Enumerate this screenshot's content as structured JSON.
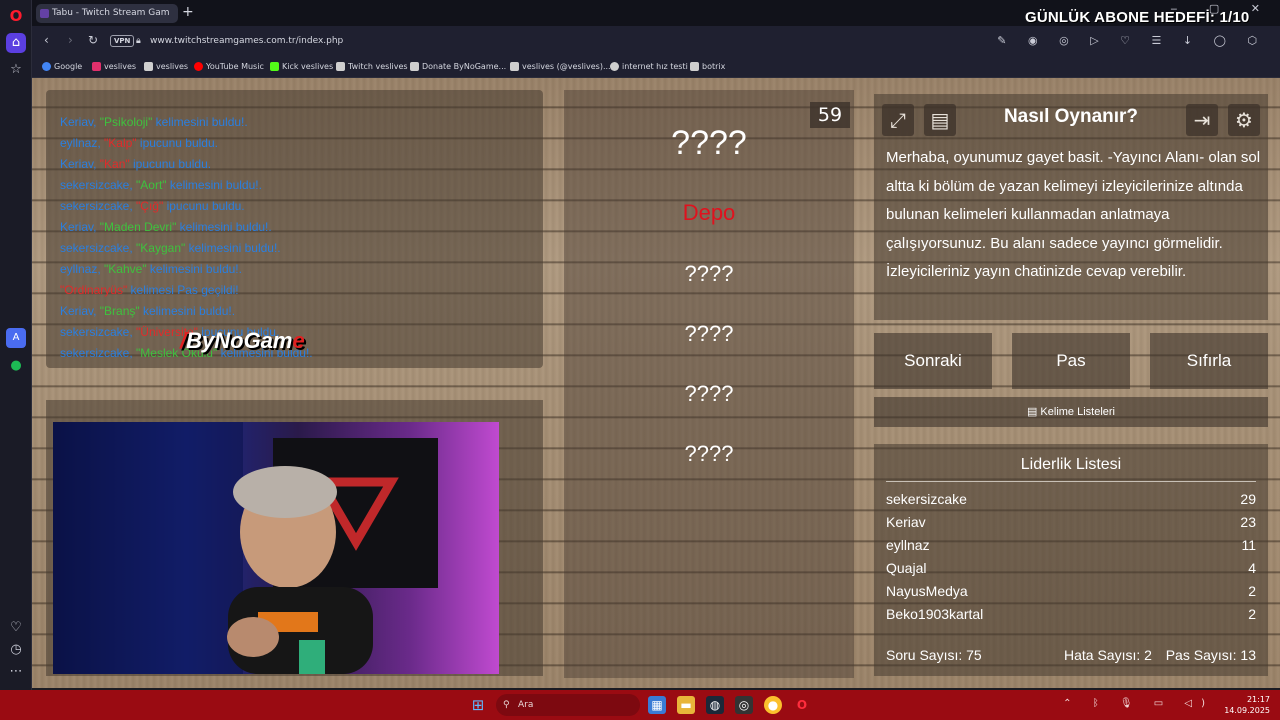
{
  "browser": {
    "tab_title": "Tabu - Twitch Stream Gam",
    "url": "www.twitchstreamgames.com.tr/index.php",
    "vpn_label": "VPN"
  },
  "bookmarks": [
    {
      "label": "Google",
      "color": "#4285f4"
    },
    {
      "label": "veslives",
      "color": "#e1306c"
    },
    {
      "label": "veslives",
      "color": "#cfcfcf"
    },
    {
      "label": "YouTube Music",
      "color": "#ff0000"
    },
    {
      "label": "Kick veslives",
      "color": "#53fc18"
    },
    {
      "label": "Twitch veslives",
      "color": "#cfcfcf"
    },
    {
      "label": "Donate ByNoGame...",
      "color": "#cfcfcf"
    },
    {
      "label": "veslives (@veslives)...",
      "color": "#cfcfcf"
    },
    {
      "label": "internet hız testi",
      "color": "#cfcfcf"
    },
    {
      "label": "botrix",
      "color": "#cfcfcf"
    }
  ],
  "stream_overlay": {
    "goal_text": "GÜNLÜK ABONE HEDEFİ: 1/10",
    "logo_text": "ByNoGam",
    "logo_accent": "e"
  },
  "chat": [
    {
      "user": "Keriav, ",
      "word": "\"Psikoloji\"",
      "word_color": "g",
      "rest": " kelimesini buldu!."
    },
    {
      "user": "eyllnaz, ",
      "word": "\"Kalp\"",
      "word_color": "r",
      "rest": " ipucunu buldu."
    },
    {
      "user": "Keriav, ",
      "word": "\"Kan\"",
      "word_color": "r",
      "rest": " ipucunu buldu."
    },
    {
      "user": "sekersizcake, ",
      "word": "\"Aort\"",
      "word_color": "g",
      "rest": " kelimesini buldu!."
    },
    {
      "user": "sekersizcake, ",
      "word": "\"Çığ\"",
      "word_color": "r",
      "rest": " ipucunu buldu."
    },
    {
      "user": "Keriav, ",
      "word": "\"Maden Devri\"",
      "word_color": "g",
      "rest": " kelimesini buldu!."
    },
    {
      "user": "sekersizcake, ",
      "word": "\"Kaygan\"",
      "word_color": "g",
      "rest": " kelimesini buldu!."
    },
    {
      "user": "eyllnaz, ",
      "word": "\"Kahve\"",
      "word_color": "g",
      "rest": " kelimesini buldu!."
    },
    {
      "user": "",
      "word": "\"Ordinaryüs\"",
      "word_color": "r",
      "rest": " kelimesi Pas geçildi!"
    },
    {
      "user": "Keriav, ",
      "word": "\"Branş\"",
      "word_color": "g",
      "rest": " kelimesini buldu!."
    },
    {
      "user": "sekersizcake, ",
      "word": "\"Üniversite\"",
      "word_color": "r",
      "rest": " ipucunu buldu."
    },
    {
      "user": "sekersizcake, ",
      "word": "\"Meslek Okulu\"",
      "word_color": "g",
      "rest": " kelimesini buldu!."
    }
  ],
  "words": {
    "main": "????",
    "hint_revealed": "Depo",
    "hints": [
      "????",
      "????",
      "????",
      "????"
    ]
  },
  "timer": "59",
  "howto": {
    "title": "Nasıl Oynanır?",
    "body": "Merhaba, oyunumuz gayet basit. -Yayıncı Alanı- olan sol altta ki bölüm de yazan kelimeyi izleyicilerinize altında bulunan kelimeleri kullanmadan anlatmaya çalışıyorsunuz. Bu alanı sadece yayıncı görmelidir. İzleyicileriniz yayın chatinizde cevap verebilir."
  },
  "controls": {
    "next": "Sonraki",
    "pass": "Pas",
    "reset": "Sıfırla",
    "word_lists": "Kelime Listeleri"
  },
  "leaderboard": {
    "title": "Liderlik Listesi",
    "rows": [
      {
        "name": "sekersizcake",
        "score": "29"
      },
      {
        "name": "Keriav",
        "score": "23"
      },
      {
        "name": "eyllnaz",
        "score": "11"
      },
      {
        "name": "Quajal",
        "score": "4"
      },
      {
        "name": "NayusMedya",
        "score": "2"
      },
      {
        "name": "Beko1903kartal",
        "score": "2"
      }
    ],
    "question_count": "Soru Sayısı: 75",
    "error_count": "Hata Sayısı: 2",
    "pass_count": "Pas Sayısı: 13"
  },
  "taskbar": {
    "search_placeholder": "Ara",
    "time": "21:17",
    "date": "14.09.2025"
  }
}
